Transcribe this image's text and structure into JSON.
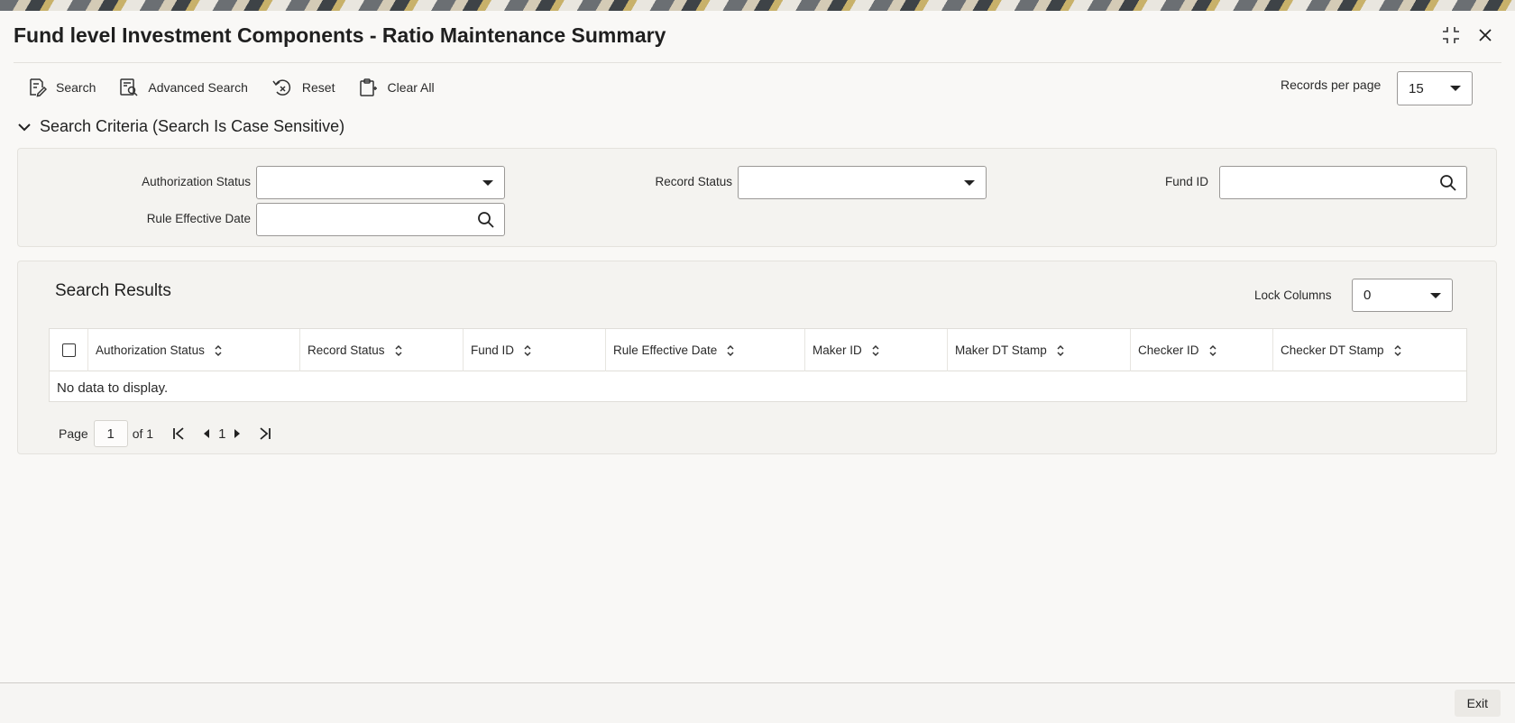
{
  "window": {
    "title": "Fund level Investment Components - Ratio Maintenance Summary",
    "controls": [
      "maximize-icon",
      "close-icon"
    ]
  },
  "toolbar": {
    "search_label": "Search",
    "advanced_search_label": "Advanced Search",
    "reset_label": "Reset",
    "clear_all_label": "Clear All",
    "records_per_page_label": "Records per page",
    "records_per_page_value": "15"
  },
  "criteria": {
    "section_title": "Search Criteria (Search Is Case Sensitive)",
    "authorization_status_label": "Authorization Status",
    "authorization_status_value": "",
    "record_status_label": "Record Status",
    "record_status_value": "",
    "fund_id_label": "Fund ID",
    "fund_id_value": "",
    "rule_effective_date_label": "Rule Effective Date",
    "rule_effective_date_value": ""
  },
  "results": {
    "title": "Search Results",
    "lock_columns_label": "Lock Columns",
    "lock_columns_value": "0",
    "columns": [
      "Authorization Status",
      "Record Status",
      "Fund ID",
      "Rule Effective Date",
      "Maker ID",
      "Maker DT Stamp",
      "Checker ID",
      "Checker DT Stamp"
    ],
    "empty_message": "No data to display."
  },
  "pager": {
    "page_label": "Page",
    "current_page": "1",
    "of_label": "of 1",
    "page_link": "1"
  },
  "footer": {
    "exit_label": "Exit"
  },
  "colors": {
    "background": "#f9f8f6",
    "panel": "#f4f3f0",
    "border": "#9a9896",
    "text": "#1d1d1d"
  }
}
